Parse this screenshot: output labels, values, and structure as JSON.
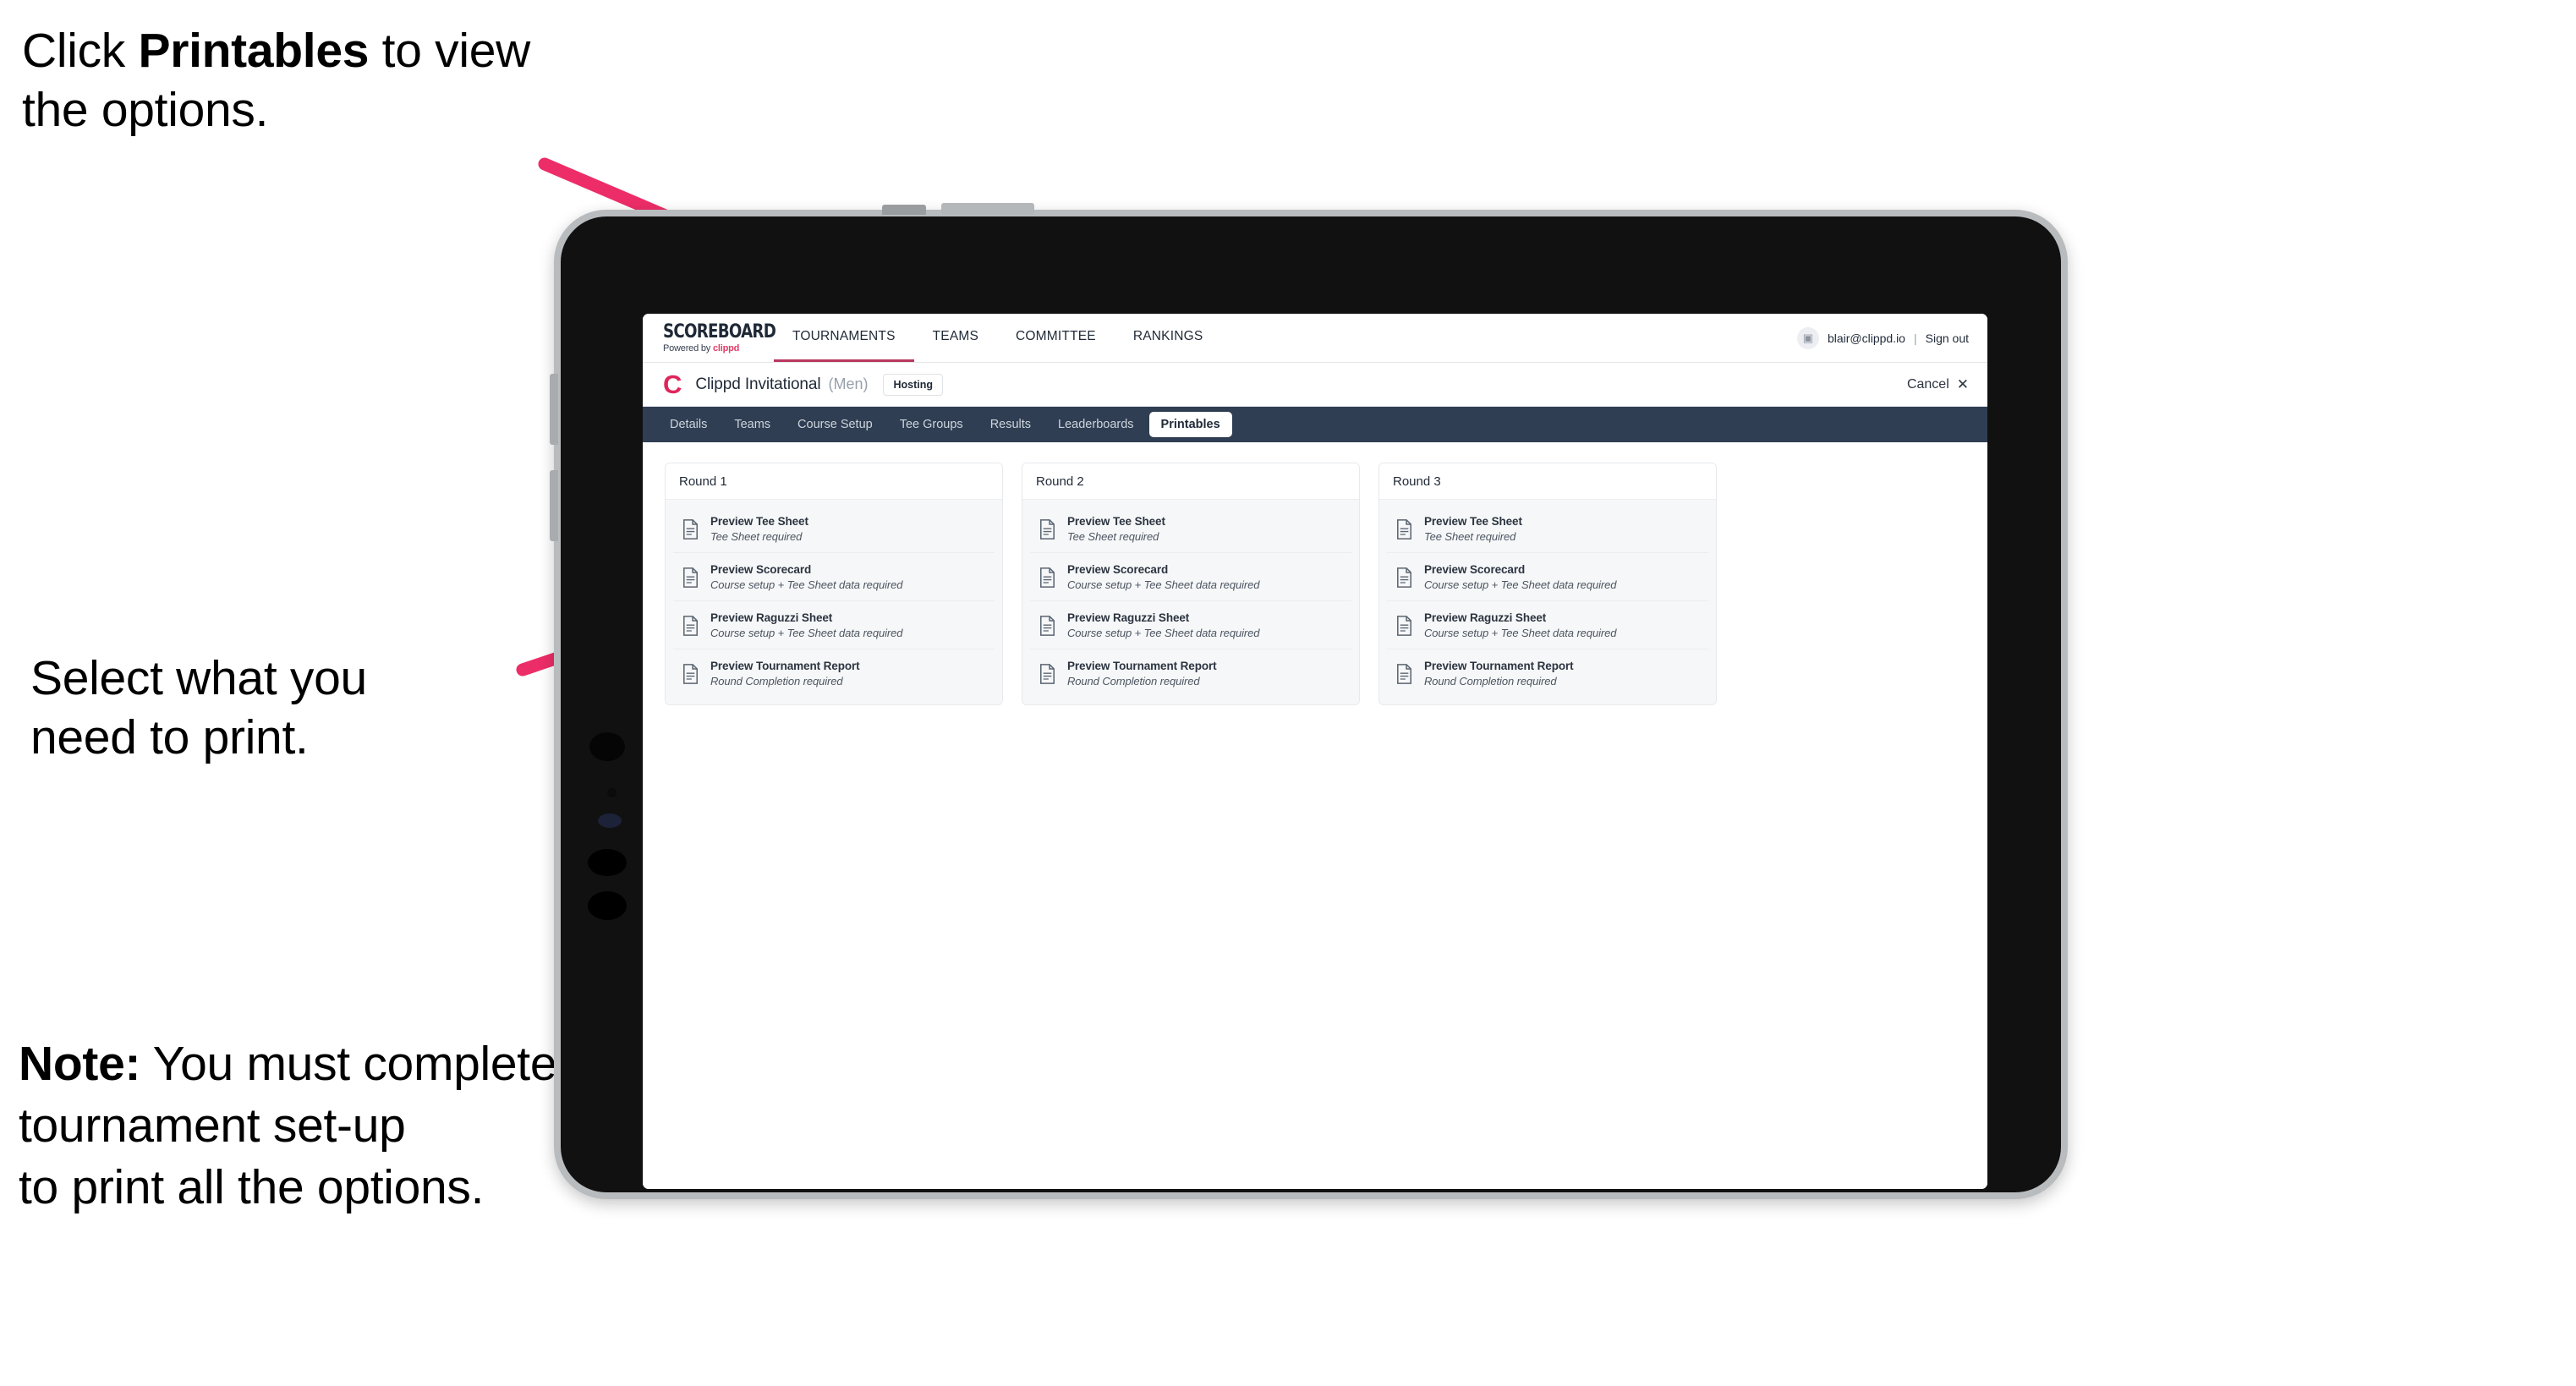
{
  "annotations": {
    "step1_prefix": "Click ",
    "step1_bold": "Printables",
    "step1_suffix": " to view the options.",
    "step2": "Select what you\nneed to print.",
    "note_bold": "Note:",
    "note_text": " You must complete the tournament set-up\nto print all the options."
  },
  "colors": {
    "accent_pink": "#ED2D68",
    "brand_pink": "#E0255B",
    "tabbar_navy": "#2F3E52"
  },
  "app": {
    "brand": {
      "title": "SCOREBOARD",
      "powered_prefix": "Powered by ",
      "powered_name": "clippd"
    },
    "topnav": [
      {
        "label": "TOURNAMENTS",
        "active": true
      },
      {
        "label": "TEAMS",
        "active": false
      },
      {
        "label": "COMMITTEE",
        "active": false
      },
      {
        "label": "RANKINGS",
        "active": false
      }
    ],
    "user": {
      "avatar_icon": "user-avatar-icon",
      "email": "blair@clippd.io",
      "separator": "|",
      "sign_out": "Sign out"
    },
    "title_bar": {
      "logo_mark": "C",
      "tournament_name": "Clippd Invitational",
      "gender": "(Men)",
      "status_badge": "Hosting",
      "cancel_label": "Cancel",
      "cancel_icon": "✕"
    },
    "section_tabs": [
      {
        "label": "Details",
        "active": false
      },
      {
        "label": "Teams",
        "active": false
      },
      {
        "label": "Course Setup",
        "active": false
      },
      {
        "label": "Tee Groups",
        "active": false
      },
      {
        "label": "Results",
        "active": false
      },
      {
        "label": "Leaderboards",
        "active": false
      },
      {
        "label": "Printables",
        "active": true
      }
    ],
    "printables": {
      "rounds": [
        {
          "title": "Round 1",
          "items": [
            {
              "title": "Preview Tee Sheet",
              "requirement": "Tee Sheet required"
            },
            {
              "title": "Preview Scorecard",
              "requirement": "Course setup + Tee Sheet data required"
            },
            {
              "title": "Preview Raguzzi Sheet",
              "requirement": "Course setup + Tee Sheet data required"
            },
            {
              "title": "Preview Tournament Report",
              "requirement": "Round Completion required"
            }
          ]
        },
        {
          "title": "Round 2",
          "items": [
            {
              "title": "Preview Tee Sheet",
              "requirement": "Tee Sheet required"
            },
            {
              "title": "Preview Scorecard",
              "requirement": "Course setup + Tee Sheet data required"
            },
            {
              "title": "Preview Raguzzi Sheet",
              "requirement": "Course setup + Tee Sheet data required"
            },
            {
              "title": "Preview Tournament Report",
              "requirement": "Round Completion required"
            }
          ]
        },
        {
          "title": "Round 3",
          "items": [
            {
              "title": "Preview Tee Sheet",
              "requirement": "Tee Sheet required"
            },
            {
              "title": "Preview Scorecard",
              "requirement": "Course setup + Tee Sheet data required"
            },
            {
              "title": "Preview Raguzzi Sheet",
              "requirement": "Course setup + Tee Sheet data required"
            },
            {
              "title": "Preview Tournament Report",
              "requirement": "Round Completion required"
            }
          ]
        }
      ]
    }
  }
}
